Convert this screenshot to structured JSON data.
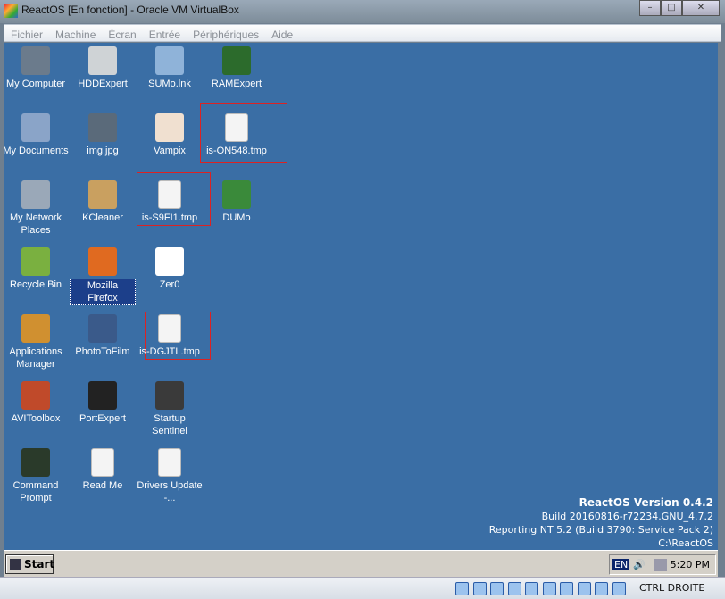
{
  "window": {
    "title": "ReactOS [En fonction] - Oracle VM VirtualBox",
    "controls": [
      "minimize",
      "maximize",
      "close"
    ]
  },
  "menu": [
    "Fichier",
    "Machine",
    "Écran",
    "Entrée",
    "Périphériques",
    "Aide"
  ],
  "icons": [
    {
      "label": "My Computer",
      "col": 0,
      "row": 0,
      "color": "#6b7b8c"
    },
    {
      "label": "HDDExpert",
      "col": 1,
      "row": 0,
      "color": "#cfd3d6"
    },
    {
      "label": "SUMo.lnk",
      "col": 2,
      "row": 0,
      "color": "#8fb3d9"
    },
    {
      "label": "RAMExpert",
      "col": 3,
      "row": 0,
      "color": "#2c6b2c"
    },
    {
      "label": "My Documents",
      "col": 0,
      "row": 1,
      "color": "#8aa4c8"
    },
    {
      "label": "img.jpg",
      "col": 1,
      "row": 1,
      "color": "#5a6a7a"
    },
    {
      "label": "Vampix",
      "col": 2,
      "row": 1,
      "color": "#f0e0d0"
    },
    {
      "label": "is-ON548.tmp",
      "col": 3,
      "row": 1,
      "file": true
    },
    {
      "label": "My Network Places",
      "col": 0,
      "row": 2,
      "color": "#9aa8b8"
    },
    {
      "label": "KCleaner",
      "col": 1,
      "row": 2,
      "color": "#c9a060"
    },
    {
      "label": "is-S9FI1.tmp",
      "col": 2,
      "row": 2,
      "file": true
    },
    {
      "label": "DUMo",
      "col": 3,
      "row": 2,
      "color": "#3a8a3a"
    },
    {
      "label": "Recycle Bin",
      "col": 0,
      "row": 3,
      "color": "#7ab040"
    },
    {
      "label": "Mozilla Firefox",
      "col": 1,
      "row": 3,
      "color": "#e06a20",
      "selected": true
    },
    {
      "label": "Zer0",
      "col": 2,
      "row": 3,
      "color": "#ffffff"
    },
    {
      "label": "Applications Manager",
      "col": 0,
      "row": 4,
      "color": "#d09030"
    },
    {
      "label": "PhotoToFilm",
      "col": 1,
      "row": 4,
      "color": "#3a5a8a"
    },
    {
      "label": "is-DGJTL.tmp",
      "col": 2,
      "row": 4,
      "file": true
    },
    {
      "label": "AVIToolbox",
      "col": 0,
      "row": 5,
      "color": "#c04a2a"
    },
    {
      "label": "PortExpert",
      "col": 1,
      "row": 5,
      "color": "#222222"
    },
    {
      "label": "Startup Sentinel",
      "col": 2,
      "row": 5,
      "color": "#3a3a3a"
    },
    {
      "label": "Command Prompt",
      "col": 0,
      "row": 6,
      "color": "#2a3a2a"
    },
    {
      "label": "Read Me",
      "col": 1,
      "row": 6,
      "file": true
    },
    {
      "label": "Drivers Update -...",
      "col": 2,
      "row": 6,
      "file": true
    }
  ],
  "version": {
    "title": "ReactOS Version 0.4.2",
    "build": "Build 20160816-r72234.GNU_4.7.2",
    "reporting": "Reporting NT 5.2 (Build 3790: Service Pack 2)",
    "path": "C:\\ReactOS"
  },
  "taskbar": {
    "start": "Start",
    "lang": "EN",
    "clock": "5:20 PM"
  },
  "statusbar": {
    "host_key": "CTRL DROITE"
  },
  "colors": {
    "desktop": "#3a6ea5",
    "highlight": "#dd2222"
  }
}
